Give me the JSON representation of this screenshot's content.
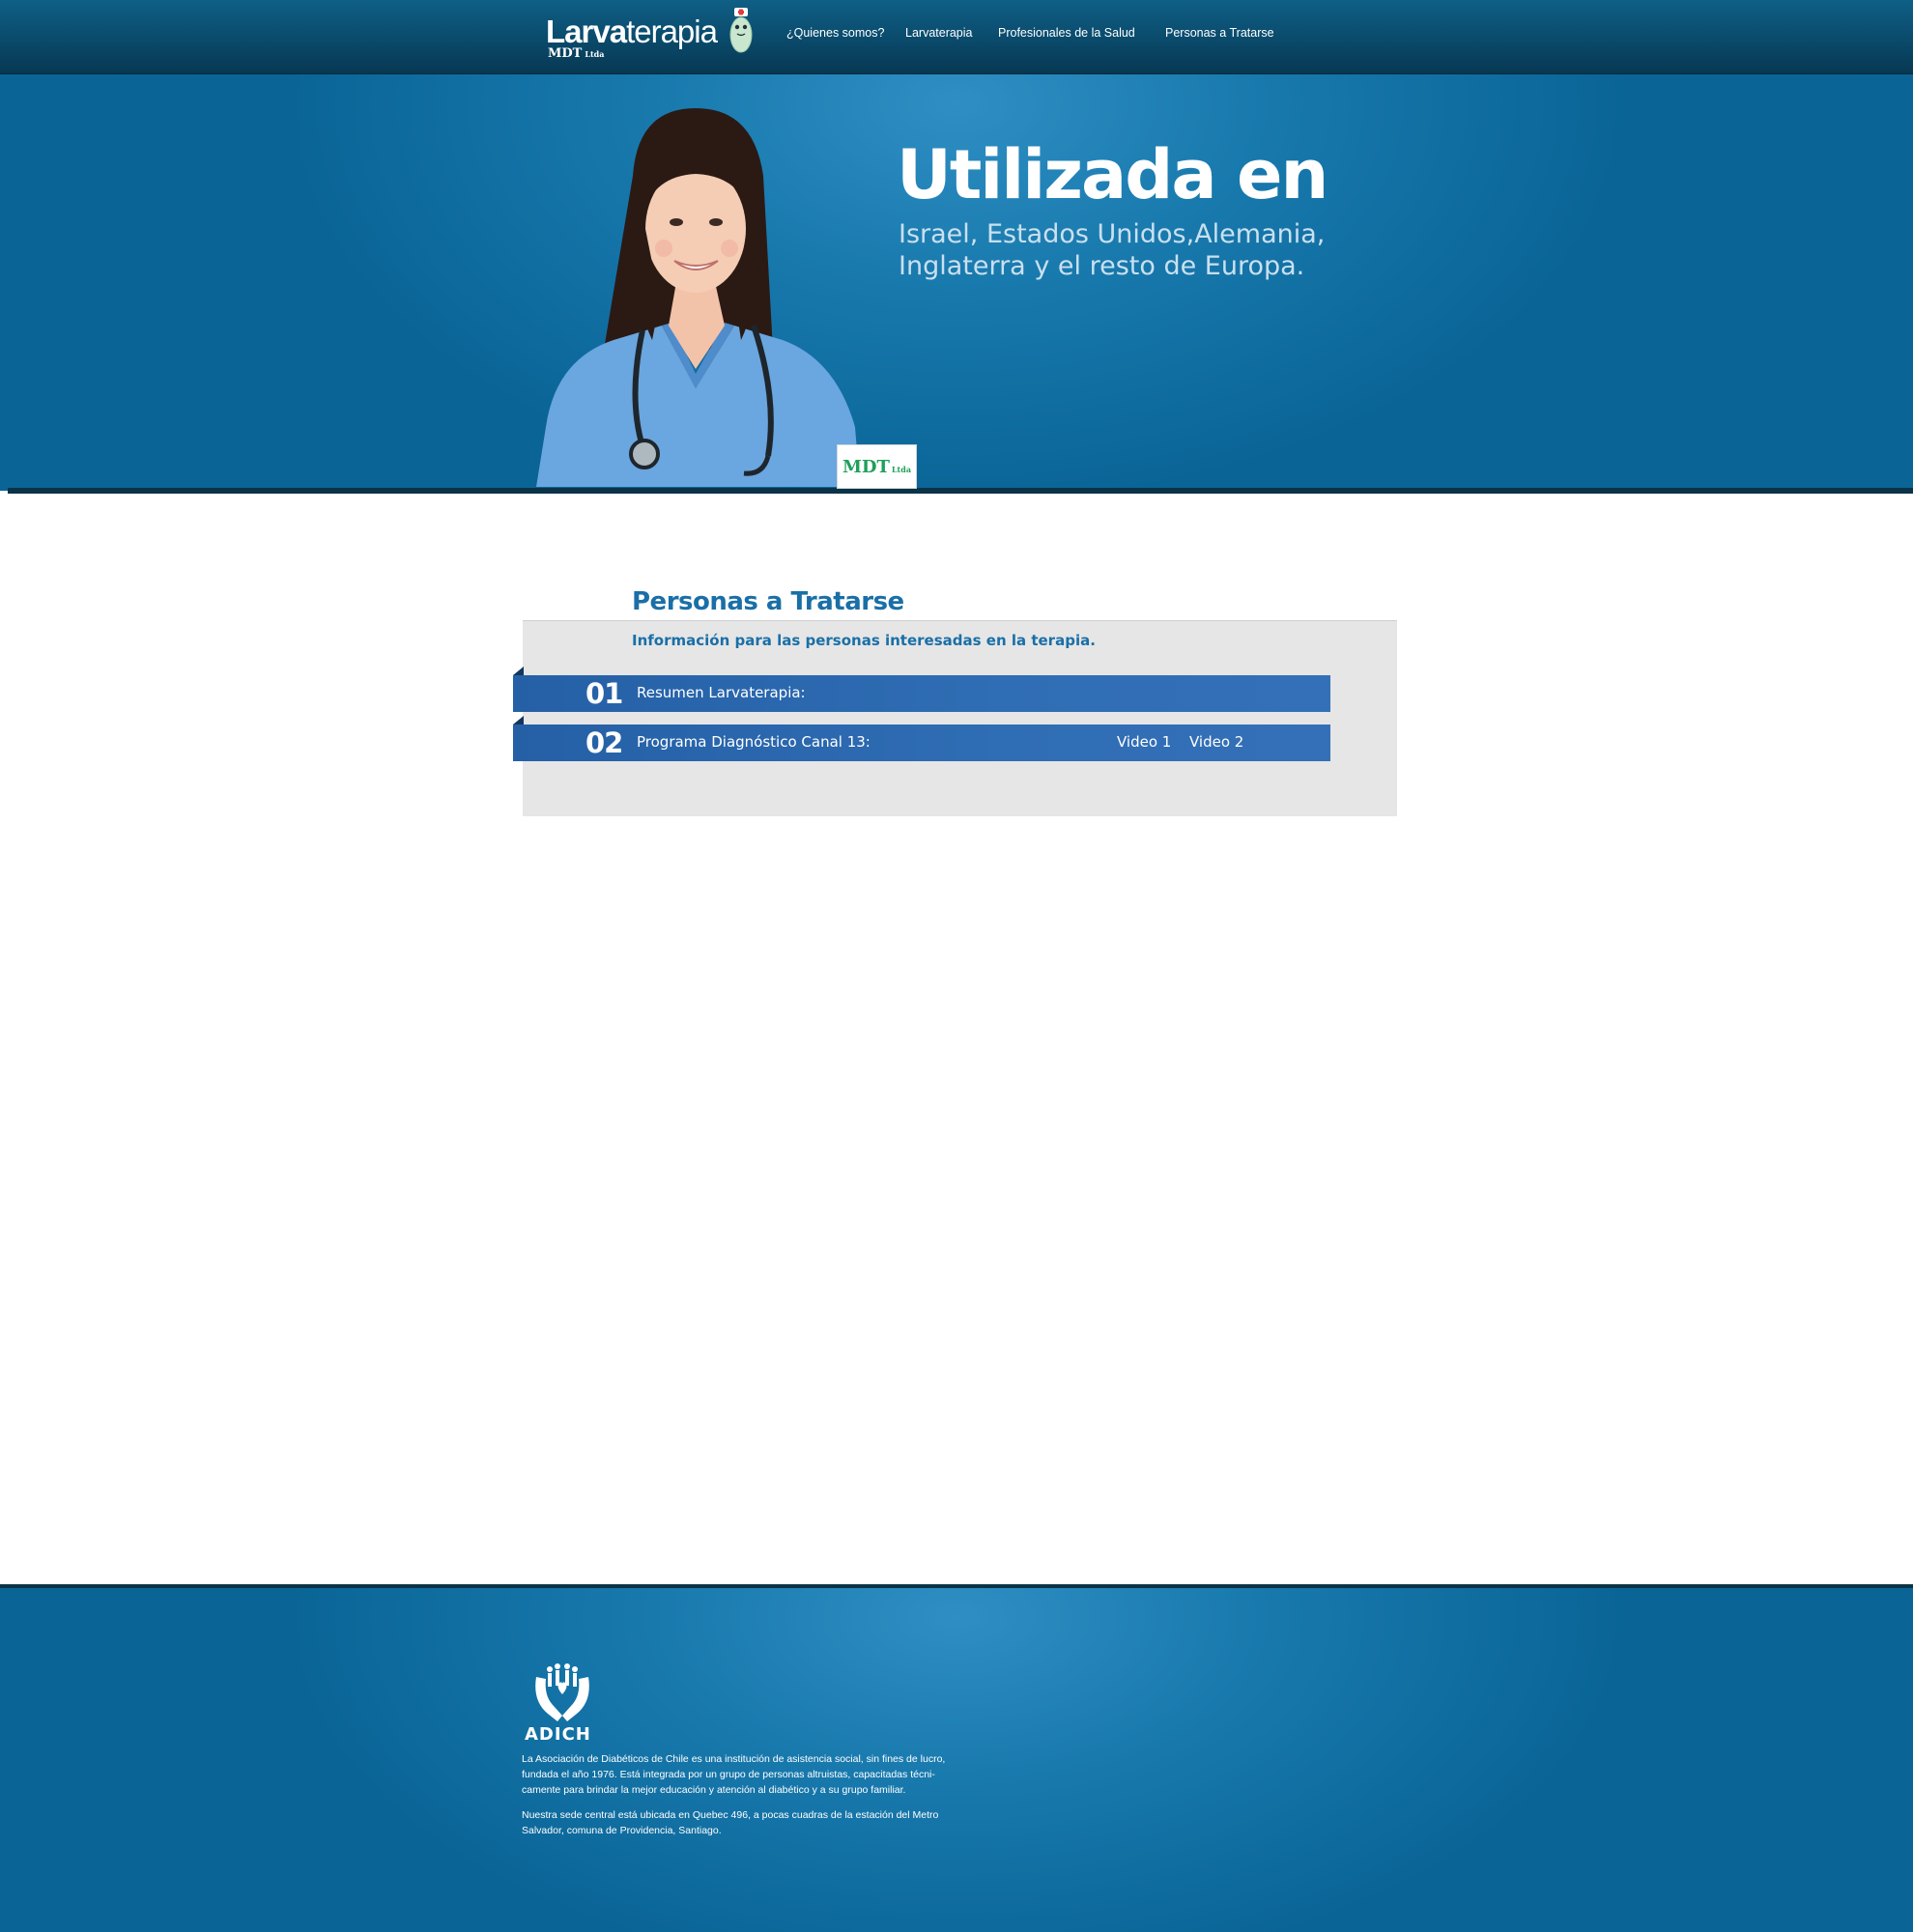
{
  "brand": {
    "name_bold": "Larva",
    "name_light": "terapia",
    "sub": "MDT",
    "sub_small": "Ltda"
  },
  "nav": {
    "items": [
      {
        "label": "¿Quienes somos?"
      },
      {
        "label": "Larvaterapia"
      },
      {
        "label": "Profesionales de la Salud"
      },
      {
        "label": "Personas a Tratarse"
      }
    ]
  },
  "hero": {
    "title": "Utilizada en",
    "subtitle": "Israel, Estados Unidos,Alemania, Inglaterra y el resto de Europa.",
    "badge": "MDT",
    "badge_small": "Ltda"
  },
  "section": {
    "title": "Personas a Tratarse",
    "subtitle": "Información para las personas interesadas en la terapia.",
    "items": [
      {
        "num": "01",
        "label": "Resumen Larvaterapia:"
      },
      {
        "num": "02",
        "label": "Programa Diagnóstico Canal 13:",
        "links": [
          "Video 1",
          "Video 2"
        ]
      }
    ]
  },
  "footer": {
    "logo_text": "ADICH",
    "paragraph1": "La Asociación de Diabéticos de Chile es una institución de asistencia social, sin fines de lucro, fundada el año 1976. Está integrada por un grupo de personas altruistas, capacitadas técni-camente para brindar la mejor educación y atención al diabético y a su grupo familiar.",
    "paragraph2": "Nuestra sede central está ubicada en Quebec 496, a pocas cuadras de la estación del Metro Salvador, comuna de Providencia, Santiago."
  },
  "colors": {
    "header": "#0a4a6b",
    "hero": "#1879ad",
    "ribbon": "#2f6db4",
    "heading": "#1a6fa7",
    "panel": "#e6e6e6"
  }
}
